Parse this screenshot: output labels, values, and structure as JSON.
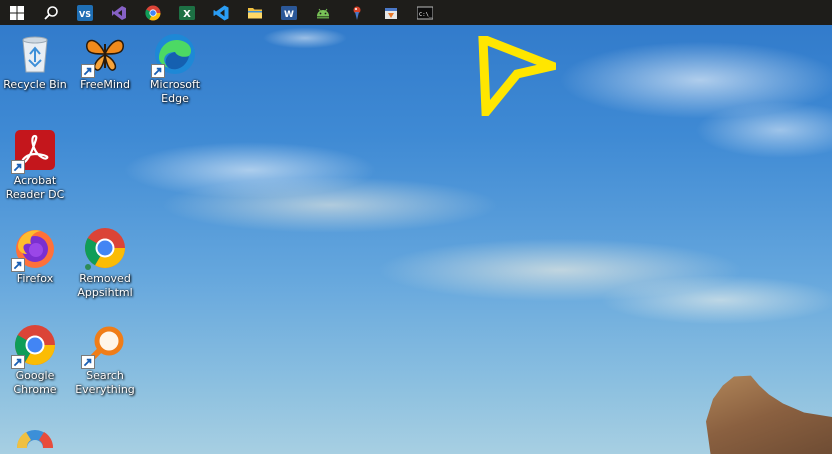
{
  "taskbar": {
    "items": [
      {
        "name": "start-button",
        "icon": "windows-logo-icon"
      },
      {
        "name": "search-button",
        "icon": "search-icon"
      },
      {
        "name": "vscode-insiders-taskbar",
        "icon": "vscode-insiders-icon",
        "text": "VS"
      },
      {
        "name": "visual-studio-taskbar",
        "icon": "visual-studio-icon"
      },
      {
        "name": "chrome-taskbar",
        "icon": "chrome-icon"
      },
      {
        "name": "excel-taskbar",
        "icon": "excel-icon",
        "text": "X"
      },
      {
        "name": "vscode-taskbar",
        "icon": "vscode-icon"
      },
      {
        "name": "file-explorer-taskbar",
        "icon": "folder-icon"
      },
      {
        "name": "word-taskbar",
        "icon": "word-icon",
        "text": "W"
      },
      {
        "name": "android-taskbar",
        "icon": "android-icon"
      },
      {
        "name": "pin-app-taskbar",
        "icon": "pin-icon"
      },
      {
        "name": "installer-taskbar",
        "icon": "installer-icon"
      },
      {
        "name": "terminal-taskbar",
        "icon": "terminal-icon",
        "text": "C:\\_"
      }
    ]
  },
  "desktop": {
    "icons": [
      {
        "label": "Recycle Bin",
        "icon": "recycle-bin-icon"
      },
      {
        "label": "FreeMind",
        "icon": "freemind-butterfly-icon"
      },
      {
        "label": "Microsoft\nEdge",
        "icon": "edge-icon"
      },
      {
        "label": "Acrobat\nReader DC",
        "icon": "acrobat-icon"
      },
      {
        "label": "Firefox",
        "icon": "firefox-icon"
      },
      {
        "label": "Removed\nAppsihtml",
        "icon": "chrome-icon"
      },
      {
        "label": "Google\nChrome",
        "icon": "chrome-icon"
      },
      {
        "label": "Search\nEverything",
        "icon": "magnifier-icon"
      },
      {
        "label": "",
        "icon": "partial-app-icon"
      }
    ]
  },
  "colors": {
    "taskbar": "#1e1d1a",
    "cursor": "#ffe600",
    "sky_top": "#2f78c9",
    "sky_bottom": "#a7cfe2"
  }
}
